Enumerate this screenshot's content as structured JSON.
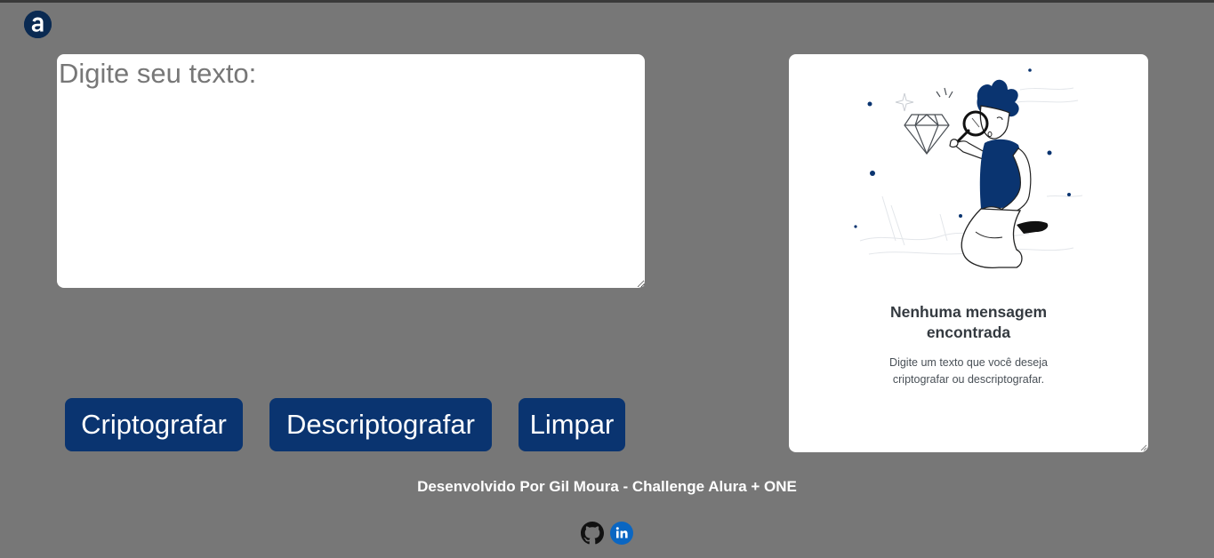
{
  "input": {
    "placeholder": "Digite seu texto:",
    "value": ""
  },
  "buttons": {
    "encrypt_label": "Criptografar",
    "decrypt_label": "Descriptografar",
    "clear_label": "Limpar"
  },
  "output": {
    "title_line1": "Nenhuma mensagem",
    "title_line2": "encontrada",
    "desc_line1": "Digite um texto que você deseja",
    "desc_line2": "criptografar ou descriptografar."
  },
  "footer": {
    "credit": "Desenvolvido Por Gil Moura - Challenge Alura + ONE"
  },
  "icons": {
    "logo": "alura-logo-icon",
    "github": "github-icon",
    "linkedin": "linkedin-icon",
    "illustration": "person-magnifier-illustration"
  },
  "colors": {
    "background": "#777777",
    "button": "#0a3470",
    "panel": "#ffffff",
    "accent_navy": "#0a2a52",
    "linkedin_blue": "#0a66c2"
  }
}
